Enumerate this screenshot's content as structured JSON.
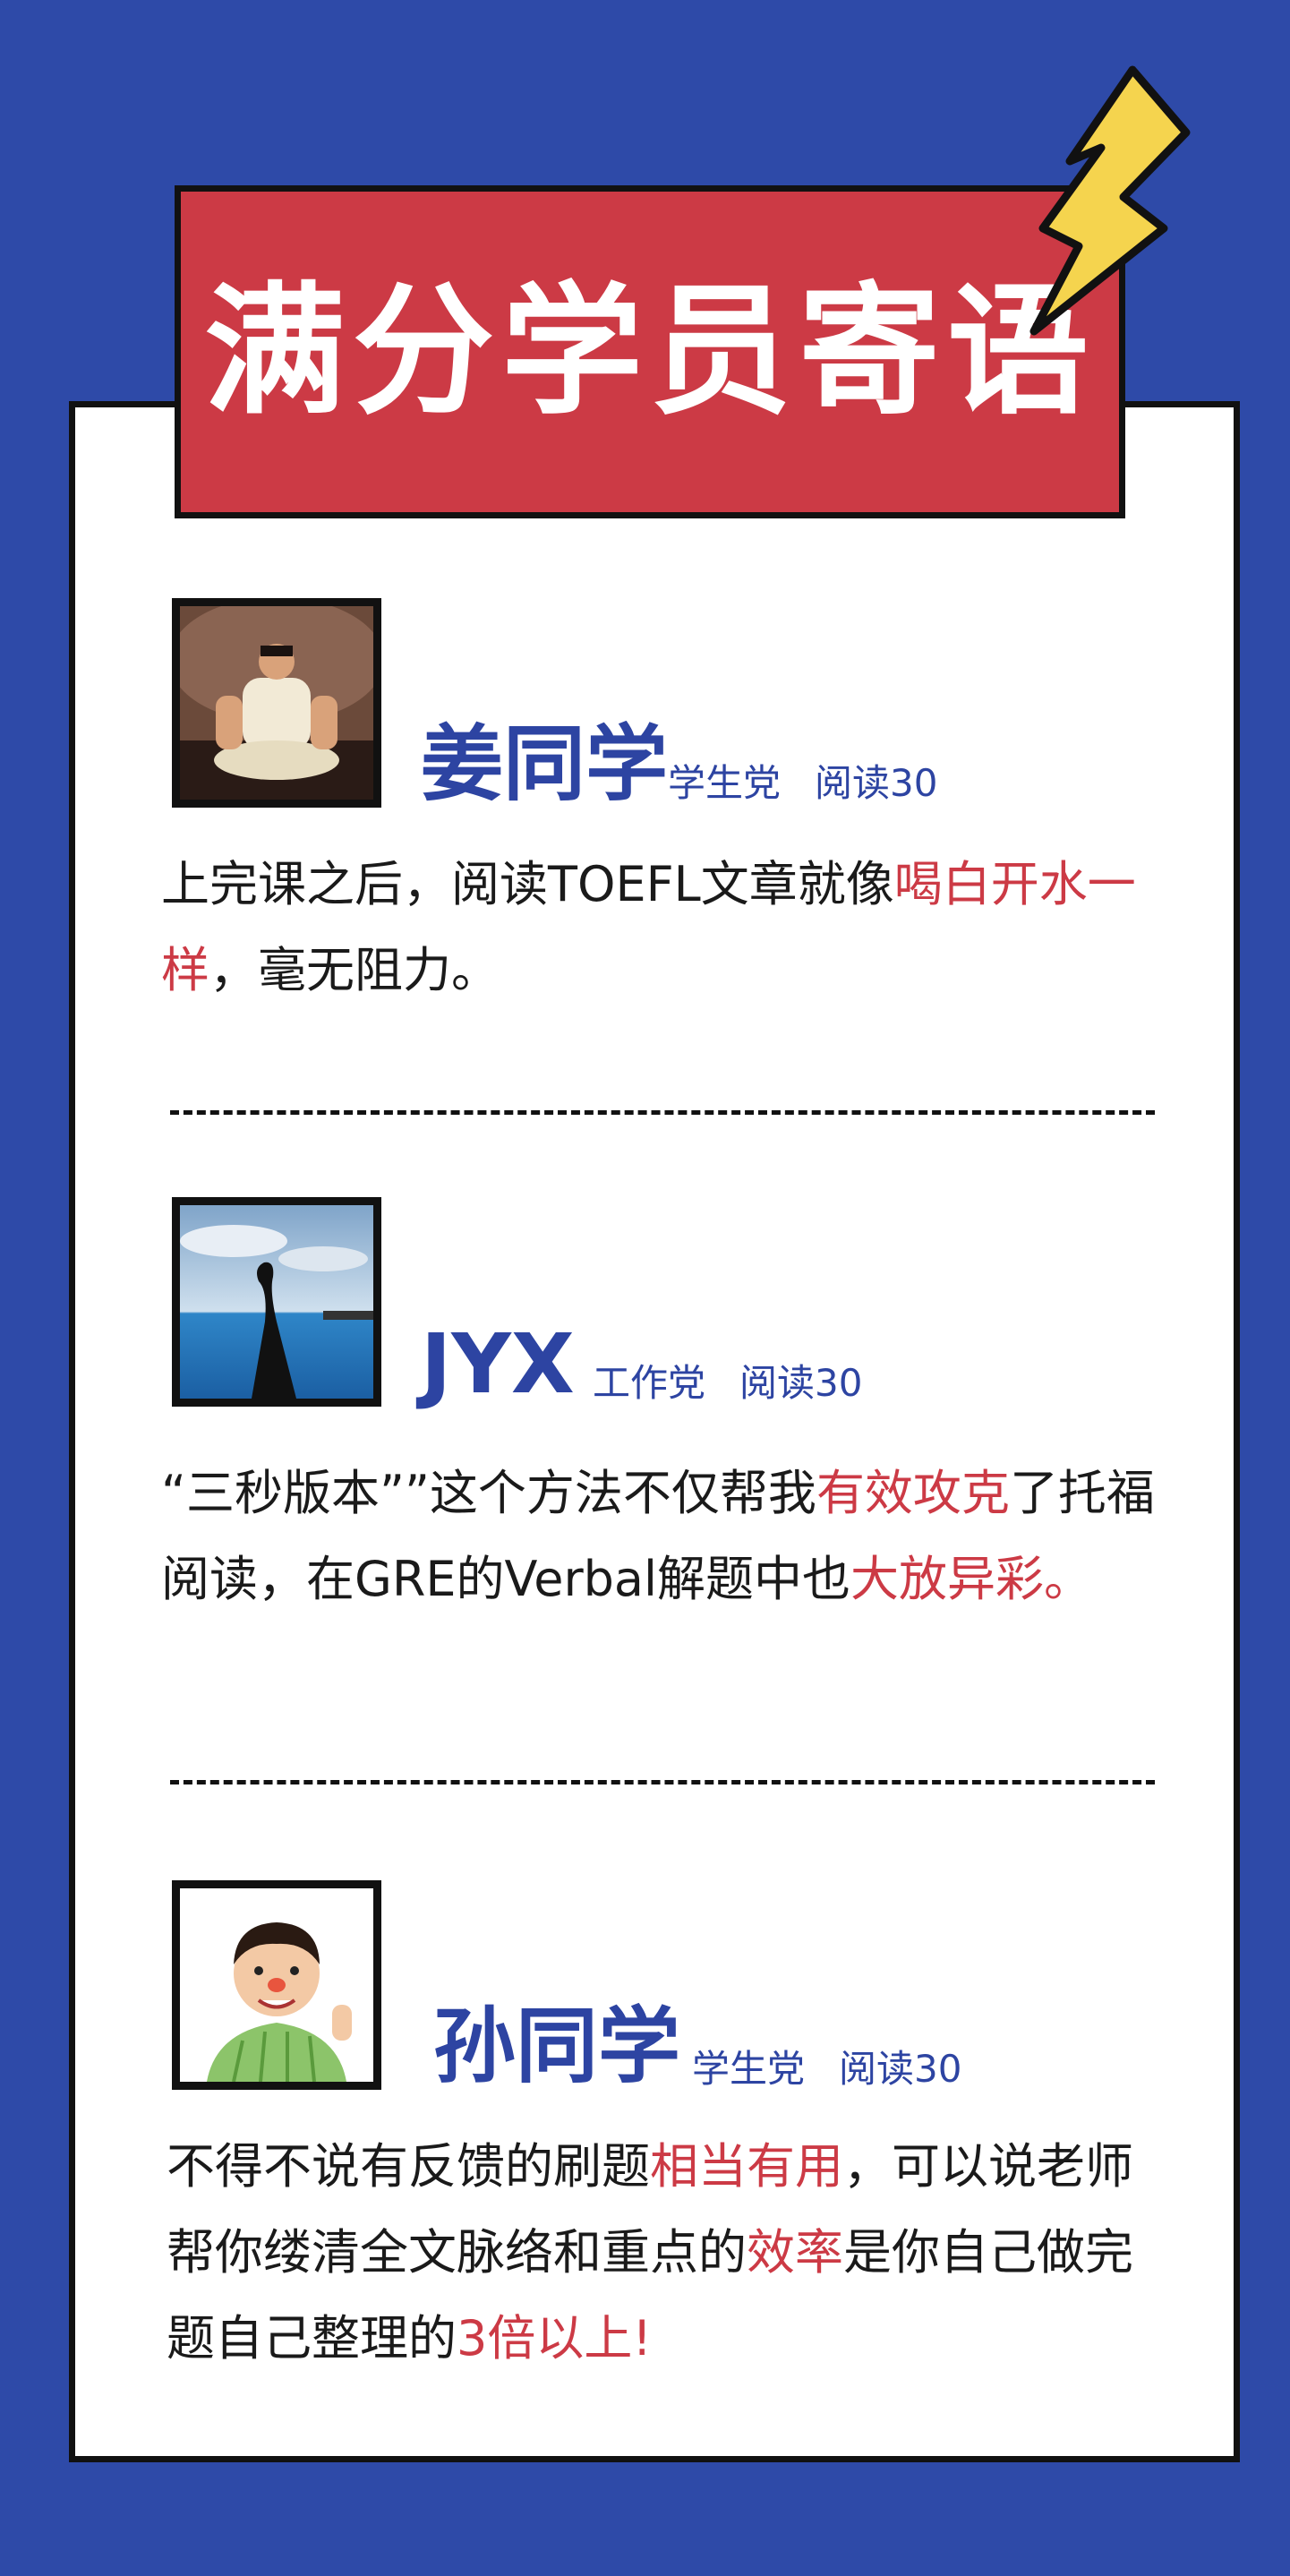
{
  "header": {
    "title": "满分学员寄语"
  },
  "testimonials": [
    {
      "name": "姜同学",
      "tag1": "学生党",
      "tag2": "阅读30",
      "quote": [
        {
          "text": "上完课之后，阅读TOEFL文章就像",
          "hl": false
        },
        {
          "text": "喝白开水一样",
          "hl": true
        },
        {
          "text": "，毫无阻力。",
          "hl": false
        }
      ]
    },
    {
      "name": "JYX",
      "tag1": "工作党",
      "tag2": "阅读30",
      "quote": [
        {
          "text": "“三秒版本””这个方法不仅帮我",
          "hl": false
        },
        {
          "text": "有效攻克",
          "hl": true
        },
        {
          "text": "了托福阅读，在GRE的Verbal解题中也",
          "hl": false
        },
        {
          "text": "大放异彩。",
          "hl": true
        }
      ]
    },
    {
      "name": "孙同学",
      "tag1": "学生党",
      "tag2": "阅读30",
      "quote": [
        {
          "text": "不得不说有反馈的刷题",
          "hl": false
        },
        {
          "text": "相当有用",
          "hl": true
        },
        {
          "text": "，可以说老师帮你缕清全文脉络和重点的",
          "hl": false
        },
        {
          "text": "效率",
          "hl": true
        },
        {
          "text": "是你自己做完题自己整理的",
          "hl": false
        },
        {
          "text": "3倍以上!",
          "hl": true
        }
      ]
    }
  ],
  "colors": {
    "background": "#2e4aa8",
    "banner": "#cc3a45",
    "accent_text": "#2d44a2",
    "highlight": "#cc3a45",
    "bolt": "#f5d44e"
  },
  "icons": [
    "lightning-bolt-icon"
  ]
}
